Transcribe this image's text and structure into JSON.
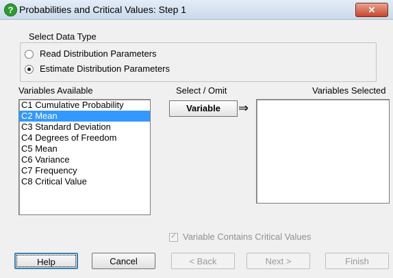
{
  "window": {
    "title": "Probabilities and Critical Values: Step 1",
    "close_label": "✕",
    "icon_glyph": "?"
  },
  "data_type": {
    "group_label": "Select Data Type",
    "options": [
      {
        "label": "Read Distribution Parameters",
        "selected": false
      },
      {
        "label": "Estimate Distribution Parameters",
        "selected": true
      }
    ]
  },
  "available": {
    "label": "Variables Available",
    "items": [
      "C1 Cumulative Probability",
      "C2 Mean",
      "C3 Standard Deviation",
      "C4 Degrees of Freedom",
      "C5 Mean",
      "C6 Variance",
      "C7 Frequency",
      "C8 Critical Value"
    ],
    "selected_index": 1
  },
  "select_omit": {
    "label": "Select / Omit",
    "button_label": "Variable",
    "arrow": "⇒"
  },
  "selected_vars": {
    "label": "Variables Selected",
    "items": []
  },
  "critical_checkbox": {
    "label": "Variable Contains Critical Values",
    "checked": true,
    "check_glyph": "✓"
  },
  "buttons": {
    "help": "Help",
    "cancel": "Cancel",
    "back": "< Back",
    "next": "Next >",
    "finish": "Finish"
  }
}
